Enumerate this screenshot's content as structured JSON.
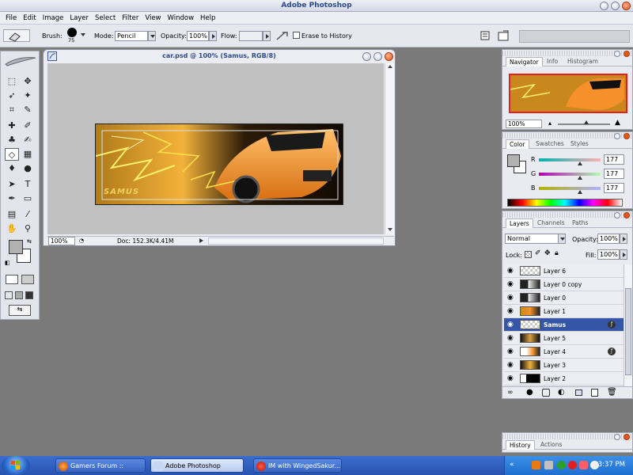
{
  "app": {
    "title": "Adobe Photoshop"
  },
  "menu": [
    "File",
    "Edit",
    "Image",
    "Layer",
    "Select",
    "Filter",
    "View",
    "Window",
    "Help"
  ],
  "options": {
    "brush_label": "Brush:",
    "brush_size": "75",
    "mode_label": "Mode:",
    "mode_value": "Pencil",
    "opacity_label": "Opacity:",
    "opacity_value": "100%",
    "flow_label": "Flow:",
    "flow_value": "",
    "erase_history": "Erase to History"
  },
  "document": {
    "title": "car.psd @ 100% (Samus, RGB/8)",
    "zoom": "100%",
    "doc_info": "Doc: 152.3K/4.41M",
    "art_text": "SAMUS"
  },
  "navigator": {
    "tabs": [
      "Navigator",
      "Info",
      "Histogram"
    ],
    "zoom": "100%",
    "zoom_level": 0.55
  },
  "color_panel": {
    "tabs": [
      "Color",
      "Swatches",
      "Styles"
    ],
    "r_label": "R",
    "g_label": "G",
    "b_label": "B",
    "r": "177",
    "g": "177",
    "b": "177"
  },
  "layers_panel": {
    "tabs": [
      "Layers",
      "Channels",
      "Paths"
    ],
    "blend_mode": "Normal",
    "opacity_label": "Opacity:",
    "opacity": "100%",
    "lock_label": "Lock:",
    "fill_label": "Fill:",
    "fill": "100%",
    "layers": [
      {
        "name": "Layer 6"
      },
      {
        "name": "Layer 0 copy"
      },
      {
        "name": "Layer 0"
      },
      {
        "name": "Layer 1"
      },
      {
        "name": "Samus"
      },
      {
        "name": "Layer 5"
      },
      {
        "name": "Layer 4"
      },
      {
        "name": "Layer 3"
      },
      {
        "name": "Layer 2"
      }
    ]
  },
  "history_panel": {
    "tabs": [
      "History",
      "Actions"
    ]
  },
  "taskbar": {
    "items": [
      "Gamers Forum :: PS2,...",
      "Adobe Photoshop",
      "IM with WingedSakur..."
    ],
    "clock": "3:37 PM"
  },
  "colors": {
    "accent": "#3555a7",
    "title_text": "#2c4a8a",
    "foreground_swatch": "#b1b1b1",
    "background_swatch": "#ffffff",
    "car_orange": "#f5902a",
    "lightning": "#ffe24a"
  }
}
